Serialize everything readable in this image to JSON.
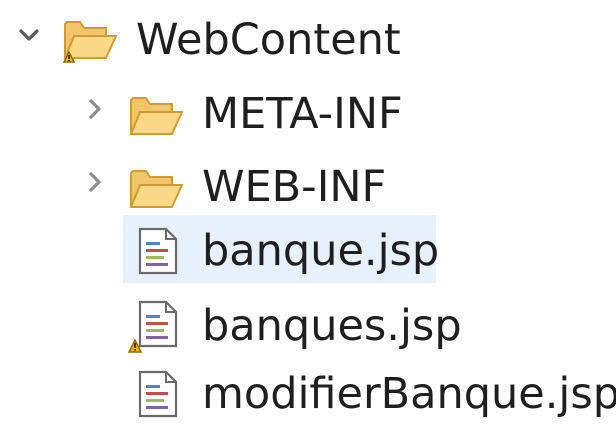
{
  "tree": {
    "root": {
      "label": "WebContent",
      "expanded": true,
      "icon": "folder-warning-icon",
      "children": [
        {
          "label": "META-INF",
          "icon": "folder-icon",
          "expanded": false
        },
        {
          "label": "WEB-INF",
          "icon": "folder-icon",
          "expanded": false
        },
        {
          "label": "banque.jsp",
          "icon": "jsp-file-icon",
          "selected": true
        },
        {
          "label": "banques.jsp",
          "icon": "jsp-file-warning-icon"
        },
        {
          "label": "modifierBanque.jsp",
          "icon": "jsp-file-icon"
        }
      ]
    }
  },
  "colors": {
    "folder": "#f7c96a",
    "folder_stroke": "#d49a35",
    "warning": "#f2b705",
    "selection": "#e7f1fb",
    "twisty": "#5a5a5a"
  }
}
